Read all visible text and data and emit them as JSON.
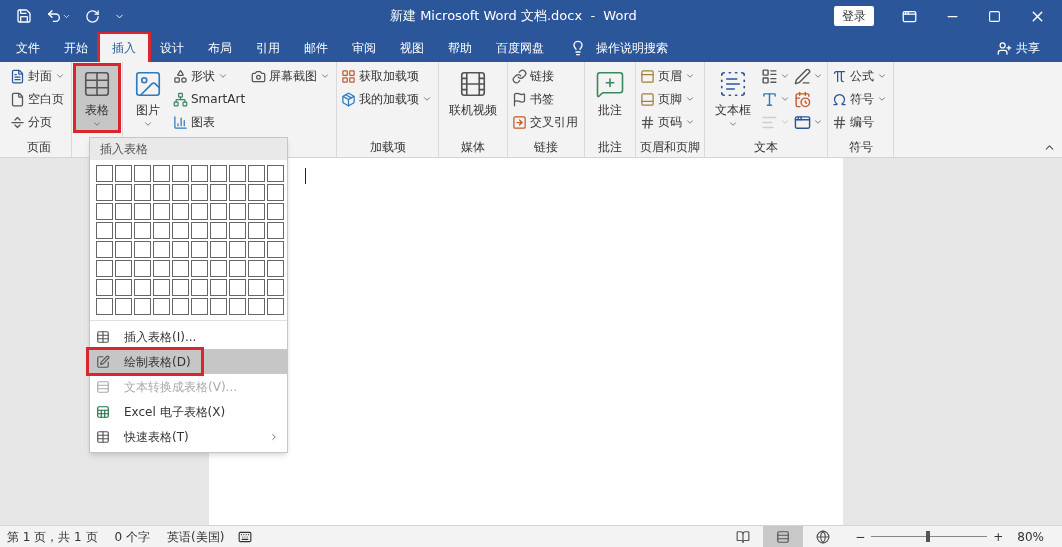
{
  "window": {
    "title": "新建 Microsoft Word 文档.docx  -  Word",
    "sign_in": "登录"
  },
  "tabs": [
    {
      "label": "文件",
      "selected": false,
      "highlighted": false
    },
    {
      "label": "开始",
      "selected": false,
      "highlighted": false
    },
    {
      "label": "插入",
      "selected": true,
      "highlighted": true
    },
    {
      "label": "设计",
      "selected": false,
      "highlighted": false
    },
    {
      "label": "布局",
      "selected": false,
      "highlighted": false
    },
    {
      "label": "引用",
      "selected": false,
      "highlighted": false
    },
    {
      "label": "邮件",
      "selected": false,
      "highlighted": false
    },
    {
      "label": "审阅",
      "selected": false,
      "highlighted": false
    },
    {
      "label": "视图",
      "selected": false,
      "highlighted": false
    },
    {
      "label": "帮助",
      "selected": false,
      "highlighted": false
    },
    {
      "label": "百度网盘",
      "selected": false,
      "highlighted": false
    }
  ],
  "tell_me": "操作说明搜索",
  "share": "共享",
  "ribbon": [
    {
      "label": "页面",
      "columns": [
        [
          {
            "kind": "small",
            "label": "封面",
            "dropdown": true
          },
          {
            "kind": "small",
            "label": "空白页",
            "dropdown": false
          },
          {
            "kind": "small",
            "label": "分页",
            "dropdown": false
          }
        ]
      ]
    },
    {
      "columns": [
        [
          {
            "kind": "large",
            "label": "表格",
            "dropdown": true,
            "pressed": true,
            "highlighted": true
          }
        ]
      ]
    },
    {
      "columns": [
        [
          {
            "kind": "large",
            "label": "图片",
            "dropdown": true
          }
        ],
        [
          {
            "kind": "small",
            "label": "形状",
            "dropdown": true
          },
          {
            "kind": "small",
            "label": "SmartArt",
            "dropdown": false
          },
          {
            "kind": "small",
            "label": "图表",
            "dropdown": false
          }
        ],
        [
          {
            "kind": "small",
            "label": "屏幕截图",
            "dropdown": true
          }
        ]
      ]
    },
    {
      "label": "加载项",
      "columns": [
        [
          {
            "kind": "small",
            "label": "获取加载项",
            "dropdown": false
          },
          {
            "kind": "small",
            "label": "我的加载项",
            "dropdown": true
          }
        ]
      ]
    },
    {
      "label": "媒体",
      "columns": [
        [
          {
            "kind": "large",
            "label": "联机视频",
            "dropdown": false
          }
        ]
      ]
    },
    {
      "label": "链接",
      "columns": [
        [
          {
            "kind": "small",
            "label": "链接",
            "dropdown": false
          },
          {
            "kind": "small",
            "label": "书签",
            "dropdown": false
          },
          {
            "kind": "small",
            "label": "交叉引用",
            "dropdown": false
          }
        ]
      ]
    },
    {
      "label": "批注",
      "columns": [
        [
          {
            "kind": "large",
            "label": "批注",
            "dropdown": false
          }
        ]
      ]
    },
    {
      "label": "页眉和页脚",
      "columns": [
        [
          {
            "kind": "small",
            "label": "页眉",
            "dropdown": true
          },
          {
            "kind": "small",
            "label": "页脚",
            "dropdown": true
          },
          {
            "kind": "small",
            "label": "页码",
            "dropdown": true
          }
        ]
      ]
    },
    {
      "label": "文本",
      "columns": [
        [
          {
            "kind": "large",
            "label": "文本框",
            "dropdown": true
          }
        ],
        [
          {
            "kind": "icon",
            "dropdown": true,
            "disabled": false
          },
          {
            "kind": "icon",
            "dropdown": true,
            "disabled": false
          },
          {
            "kind": "icon",
            "dropdown": true,
            "disabled": true
          }
        ],
        [
          {
            "kind": "icon",
            "dropdown": true
          },
          {
            "kind": "icon",
            "dropdown": false
          },
          {
            "kind": "icon",
            "dropdown": true
          }
        ]
      ]
    },
    {
      "label": "符号",
      "columns": [
        [
          {
            "kind": "small",
            "label": "公式",
            "dropdown": true
          },
          {
            "kind": "small",
            "label": "符号",
            "dropdown": true
          },
          {
            "kind": "small",
            "label": "编号",
            "dropdown": false
          }
        ]
      ]
    }
  ],
  "table_menu": {
    "title": "插入表格",
    "items": [
      {
        "label": "插入表格(I)...",
        "selected": false,
        "disabled": false,
        "submenu": false,
        "highlighted": false
      },
      {
        "label": "绘制表格(D)",
        "selected": true,
        "disabled": false,
        "submenu": false,
        "highlighted": true
      },
      {
        "label": "文本转换成表格(V)...",
        "selected": false,
        "disabled": true,
        "submenu": false,
        "highlighted": false
      },
      {
        "label": "Excel 电子表格(X)",
        "selected": false,
        "disabled": false,
        "submenu": false,
        "highlighted": false
      },
      {
        "label": "快速表格(T)",
        "selected": false,
        "disabled": false,
        "submenu": true,
        "highlighted": false
      }
    ]
  },
  "status_bar": {
    "page": "第 1 页，共 1 页",
    "words": "0 个字",
    "language": "英语(美国)",
    "views": [
      {
        "selected": false
      },
      {
        "selected": true
      },
      {
        "selected": false
      }
    ],
    "zoom_out": "−",
    "zoom_in": "+",
    "zoom": {
      "level": 0.49
    },
    "zoom_text": "80%"
  }
}
